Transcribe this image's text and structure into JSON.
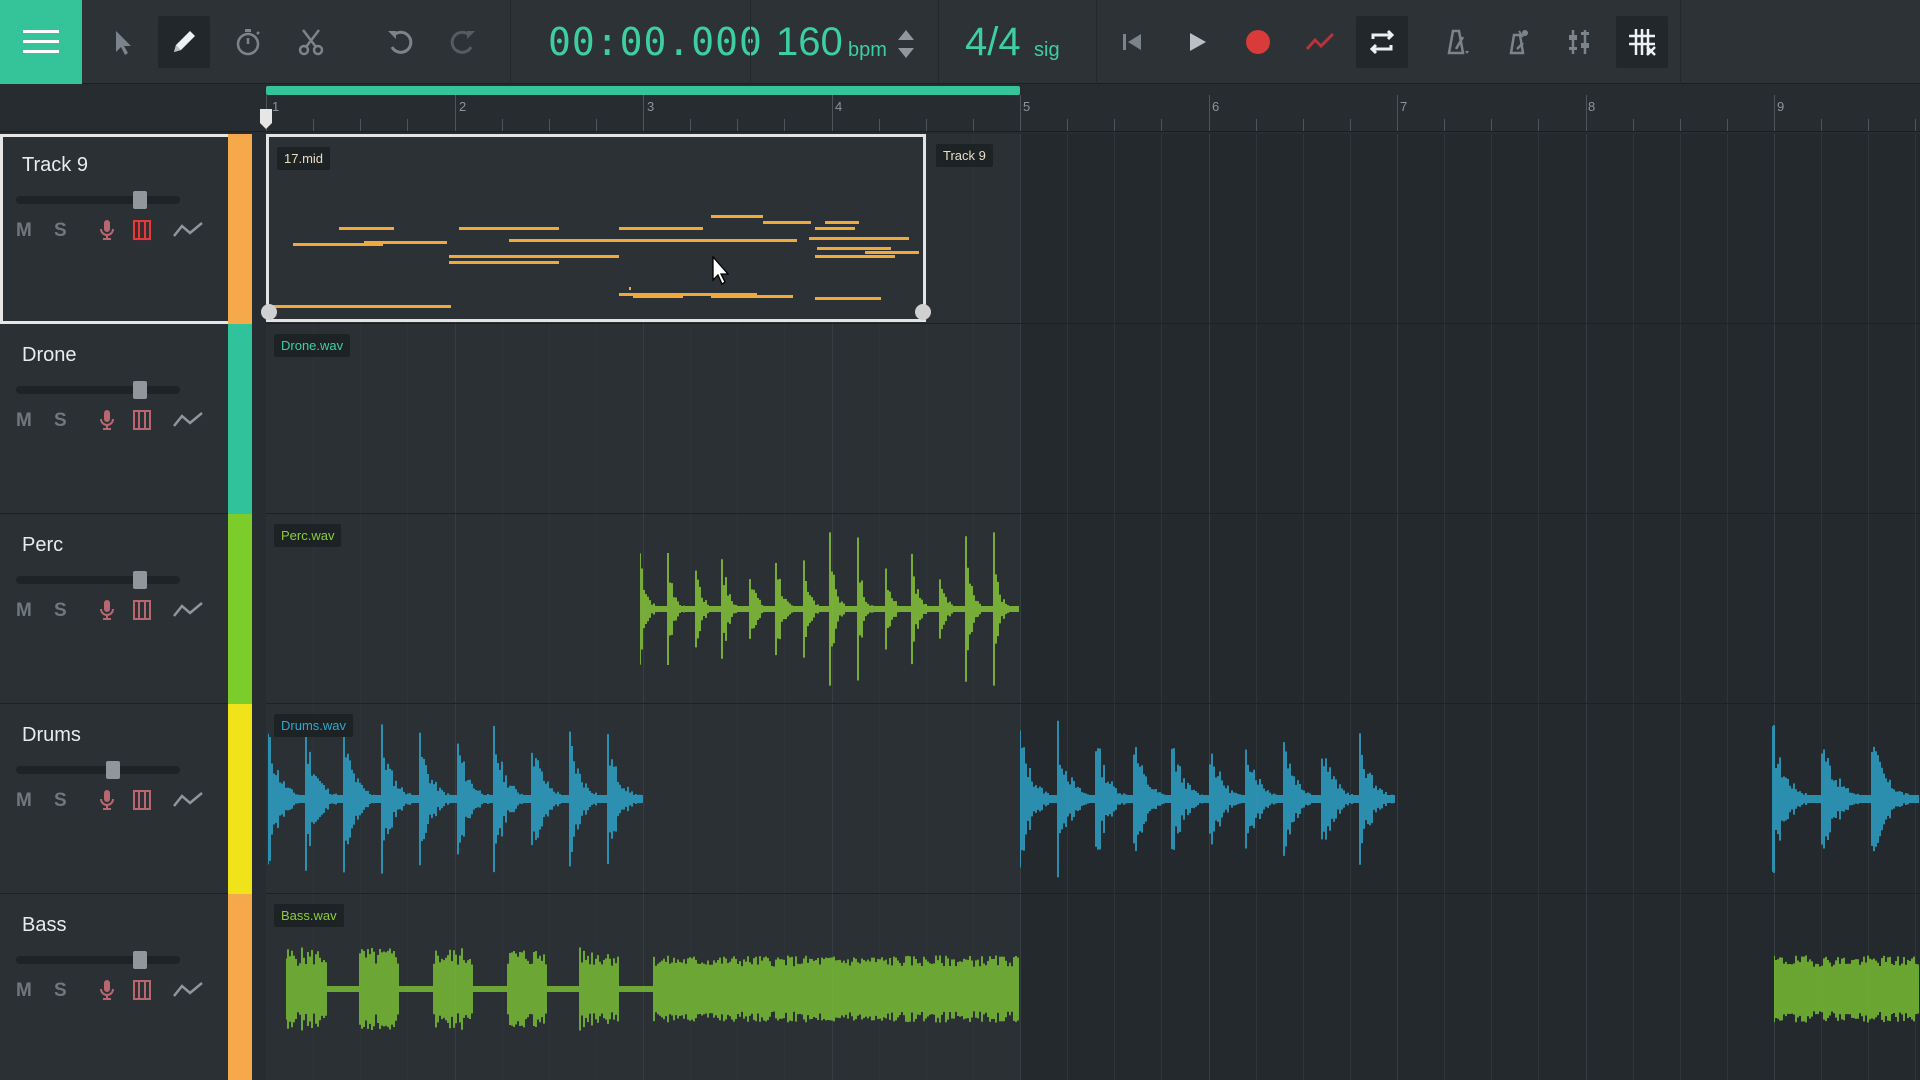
{
  "toolbar": {
    "time": "00:00.000",
    "bpm_value": "160",
    "bpm_unit": "bpm",
    "sig_value": "4/4",
    "sig_unit": "sig"
  },
  "ruler": {
    "bars": [
      "1",
      "2",
      "3",
      "4",
      "5",
      "6",
      "7",
      "8",
      "9"
    ]
  },
  "tracks": [
    {
      "name": "Track 9",
      "color": "#f6a94a",
      "clip": "17.mid",
      "second_clip": "Track 9",
      "volume": 0.78,
      "keys_active": true
    },
    {
      "name": "Drone",
      "color": "#30c39b",
      "clip": "Drone.wav",
      "volume": 0.78
    },
    {
      "name": "Perc",
      "color": "#7ccd2c",
      "clip": "Perc.wav",
      "volume": 0.78
    },
    {
      "name": "Drums",
      "color": "#f1e31a",
      "clip": "Drums.wav",
      "volume": 0.6
    },
    {
      "name": "Bass",
      "color": "#f6a94a",
      "clip": "Bass.wav",
      "volume": 0.78
    }
  ],
  "track_buttons": {
    "mute": "M",
    "solo": "S"
  },
  "colors": {
    "accent": "#35c49a",
    "midi_note": "#f2a93b",
    "perc_wave": "#8ccc3a",
    "drums_wave": "#2ea8cf",
    "bass_wave": "#7cc535",
    "record": "#d93a3a"
  },
  "icons": [
    "menu-icon",
    "pointer-icon",
    "pencil-icon",
    "stopwatch-icon",
    "scissors-icon",
    "undo-icon",
    "redo-icon",
    "skip-back-icon",
    "play-icon",
    "record-icon",
    "automation-icon",
    "loop-icon",
    "metronome-icon",
    "count-in-icon",
    "mixer-icon",
    "snap-grid-icon"
  ]
}
